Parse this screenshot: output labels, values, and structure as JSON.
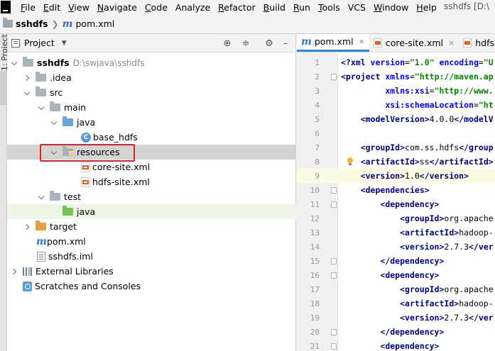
{
  "menu": {
    "items": [
      {
        "u": "F",
        "rest": "ile"
      },
      {
        "u": "E",
        "rest": "dit"
      },
      {
        "u": "V",
        "rest": "iew"
      },
      {
        "u": "N",
        "rest": "avigate"
      },
      {
        "u": "C",
        "rest": "ode"
      },
      {
        "u": "",
        "rest": "Analyze"
      },
      {
        "u": "R",
        "rest": "efactor"
      },
      {
        "u": "B",
        "rest": "uild"
      },
      {
        "u": "R",
        "rest": "un"
      },
      {
        "u": "T",
        "rest": "ools"
      },
      {
        "u": "",
        "rest": "VCS"
      },
      {
        "u": "W",
        "rest": "indow"
      },
      {
        "u": "H",
        "rest": "elp"
      }
    ],
    "window_title": "sshdfs [D:\\"
  },
  "breadcrumb": {
    "project": "sshdfs",
    "file": "pom.xml"
  },
  "left_strip": {
    "label": "1: Project"
  },
  "project_panel": {
    "title": "Project",
    "tree": [
      {
        "label": "sshdfs",
        "hint": "D:\\swjava\\sshdfs",
        "bold": true
      },
      {
        "label": ".idea"
      },
      {
        "label": "src"
      },
      {
        "label": "main"
      },
      {
        "label": "java"
      },
      {
        "label": "base_hdfs",
        "icon_letter": "C"
      },
      {
        "label": "resources"
      },
      {
        "label": "core-site.xml"
      },
      {
        "label": "hdfs-site.xml"
      },
      {
        "label": "test"
      },
      {
        "label": "java"
      },
      {
        "label": "target"
      },
      {
        "label": "pom.xml",
        "icon_letter": "m"
      },
      {
        "label": "sshdfs.iml"
      },
      {
        "label": "External Libraries"
      },
      {
        "label": "Scratches and Consoles"
      }
    ]
  },
  "editor": {
    "tabs": [
      {
        "label": "pom.xml",
        "icon_letter": "m"
      },
      {
        "label": "core-site.xml"
      },
      {
        "label": "hdfs-"
      }
    ],
    "close_glyph": "×",
    "lines": [
      {
        "n": "1",
        "parts": [
          [
            "tag",
            "<?xml "
          ],
          [
            "attr",
            "version"
          ],
          [
            "txt",
            "="
          ],
          [
            "str",
            "\"1.0\""
          ],
          [
            "txt",
            " "
          ],
          [
            "attr",
            "encoding"
          ],
          [
            "txt",
            "="
          ],
          [
            "str",
            "\"U"
          ]
        ]
      },
      {
        "n": "2",
        "parts": [
          [
            "tag",
            "<project "
          ],
          [
            "attr",
            "xmlns"
          ],
          [
            "txt",
            "="
          ],
          [
            "str",
            "\"http://maven.ap"
          ]
        ]
      },
      {
        "n": "3",
        "parts": [
          [
            "txt",
            "         "
          ],
          [
            "attr",
            "xmlns:xsi"
          ],
          [
            "txt",
            "="
          ],
          [
            "str",
            "\"http://www."
          ]
        ]
      },
      {
        "n": "4",
        "parts": [
          [
            "txt",
            "         "
          ],
          [
            "attr",
            "xsi:schemaLocation"
          ],
          [
            "txt",
            "="
          ],
          [
            "str",
            "\"ht"
          ]
        ]
      },
      {
        "n": "5",
        "parts": [
          [
            "txt",
            "    "
          ],
          [
            "tag",
            "<modelVersion>"
          ],
          [
            "txt",
            "4.0.0"
          ],
          [
            "tag",
            "</modelV"
          ]
        ]
      },
      {
        "n": "6",
        "parts": []
      },
      {
        "n": "7",
        "parts": [
          [
            "txt",
            "    "
          ],
          [
            "tag",
            "<groupId>"
          ],
          [
            "txt",
            "com.ss.hdfs"
          ],
          [
            "tag",
            "</group"
          ]
        ]
      },
      {
        "n": "8",
        "parts": [
          [
            "txt",
            "    "
          ],
          [
            "tag",
            "<artifactId>"
          ],
          [
            "txt",
            "ss"
          ],
          [
            "tag",
            "</artifactId>"
          ]
        ]
      },
      {
        "n": "9",
        "parts": [
          [
            "txt",
            "    "
          ],
          [
            "tag",
            "<version>"
          ],
          [
            "txt",
            "1.0"
          ],
          [
            "tag",
            "</version>"
          ]
        ]
      },
      {
        "n": "10",
        "parts": [
          [
            "txt",
            "    "
          ],
          [
            "tag",
            "<dependencies>"
          ]
        ]
      },
      {
        "n": "11",
        "parts": [
          [
            "txt",
            "        "
          ],
          [
            "tag",
            "<dependency>"
          ]
        ]
      },
      {
        "n": "12",
        "parts": [
          [
            "txt",
            "            "
          ],
          [
            "tag",
            "<groupId>"
          ],
          [
            "txt",
            "org.apache"
          ]
        ]
      },
      {
        "n": "13",
        "parts": [
          [
            "txt",
            "            "
          ],
          [
            "tag",
            "<artifactId>"
          ],
          [
            "txt",
            "hadoop-"
          ]
        ]
      },
      {
        "n": "14",
        "parts": [
          [
            "txt",
            "            "
          ],
          [
            "tag",
            "<version>"
          ],
          [
            "txt",
            "2.7.3"
          ],
          [
            "tag",
            "</ver"
          ]
        ]
      },
      {
        "n": "15",
        "parts": [
          [
            "txt",
            "        "
          ],
          [
            "tag",
            "</dependency>"
          ]
        ]
      },
      {
        "n": "16",
        "parts": [
          [
            "txt",
            "        "
          ],
          [
            "tag",
            "<dependency>"
          ]
        ]
      },
      {
        "n": "17",
        "parts": [
          [
            "txt",
            "            "
          ],
          [
            "tag",
            "<groupId>"
          ],
          [
            "txt",
            "org.apache"
          ]
        ]
      },
      {
        "n": "18",
        "parts": [
          [
            "txt",
            "            "
          ],
          [
            "tag",
            "<artifactId>"
          ],
          [
            "txt",
            "hadoop-"
          ]
        ]
      },
      {
        "n": "19",
        "parts": [
          [
            "txt",
            "            "
          ],
          [
            "tag",
            "<version>"
          ],
          [
            "txt",
            "2.7.3"
          ],
          [
            "tag",
            "</ver"
          ]
        ]
      },
      {
        "n": "20",
        "parts": [
          [
            "txt",
            "        "
          ],
          [
            "tag",
            "</dependency>"
          ]
        ]
      },
      {
        "n": "21",
        "parts": [
          [
            "txt",
            "        "
          ],
          [
            "tag",
            "<dependency>"
          ]
        ]
      }
    ]
  }
}
